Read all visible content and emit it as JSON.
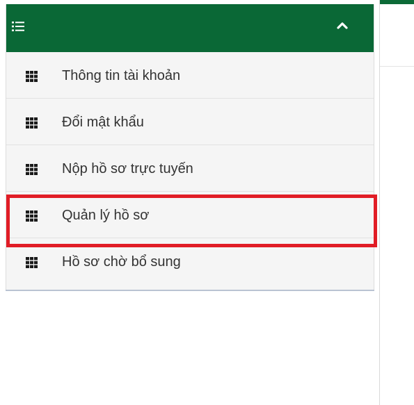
{
  "sidebar": {
    "header": {
      "menu_icon": "list-icon",
      "collapse_icon": "chevron-up-icon",
      "background_color": "#0a6836"
    },
    "items": [
      {
        "label": "Thông tin tài khoản",
        "icon": "grid-icon"
      },
      {
        "label": "Đổi mật khẩu",
        "icon": "grid-icon"
      },
      {
        "label": "Nộp hồ sơ trực tuyến",
        "icon": "grid-icon"
      },
      {
        "label": "Quản lý hồ sơ",
        "icon": "grid-icon",
        "highlighted": true
      },
      {
        "label": "Hồ sơ chờ bổ sung",
        "icon": "grid-icon"
      }
    ]
  },
  "highlight_color": "#e11d26"
}
